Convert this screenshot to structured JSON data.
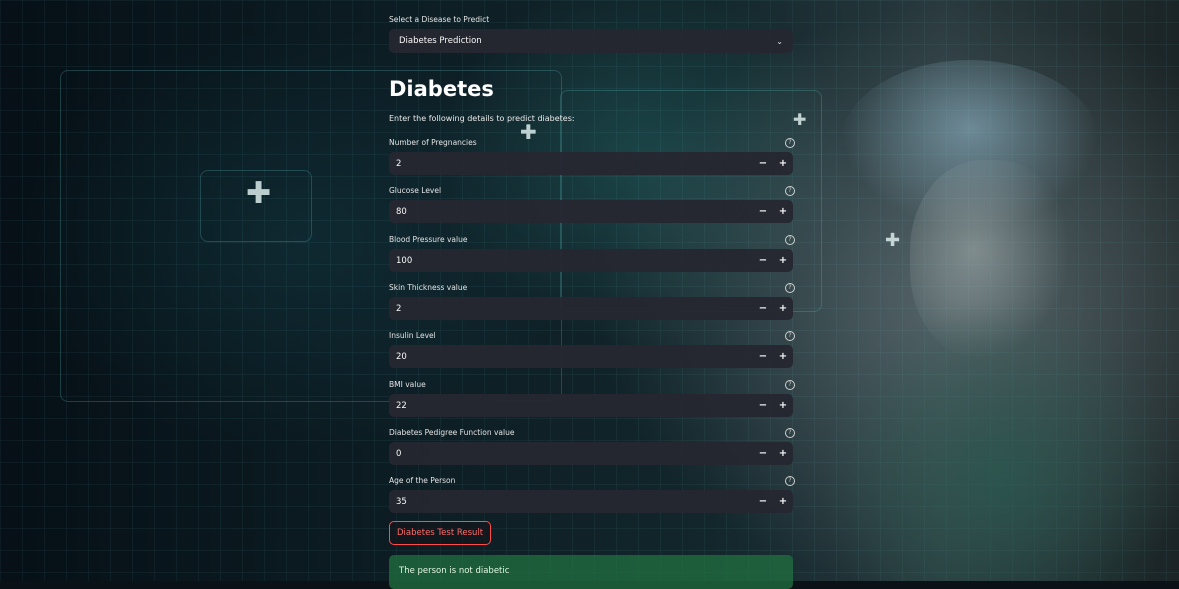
{
  "selector": {
    "label": "Select a Disease to Predict",
    "value": "Diabetes Prediction"
  },
  "page": {
    "title": "Diabetes",
    "intro": "Enter the following details to predict diabetes:"
  },
  "fields": [
    {
      "label": "Number of Pregnancies",
      "value": "2"
    },
    {
      "label": "Glucose Level",
      "value": "80"
    },
    {
      "label": "Blood Pressure value",
      "value": "100"
    },
    {
      "label": "Skin Thickness value",
      "value": "2"
    },
    {
      "label": "Insulin Level",
      "value": "20"
    },
    {
      "label": "BMI value",
      "value": "22"
    },
    {
      "label": "Diabetes Pedigree Function value",
      "value": "0"
    },
    {
      "label": "Age of the Person",
      "value": "35"
    }
  ],
  "controls": {
    "minus": "−",
    "plus": "+",
    "help": "?",
    "chevron": "⌄"
  },
  "submit_label": "Diabetes Test Result",
  "result_text": "The person is not diabetic",
  "colors": {
    "accent": "#ff4b4b",
    "input_bg": "#262730",
    "success_bg": "#217040"
  },
  "icons": [
    "chevron-down-icon",
    "help-icon",
    "minus-icon",
    "plus-icon"
  ]
}
